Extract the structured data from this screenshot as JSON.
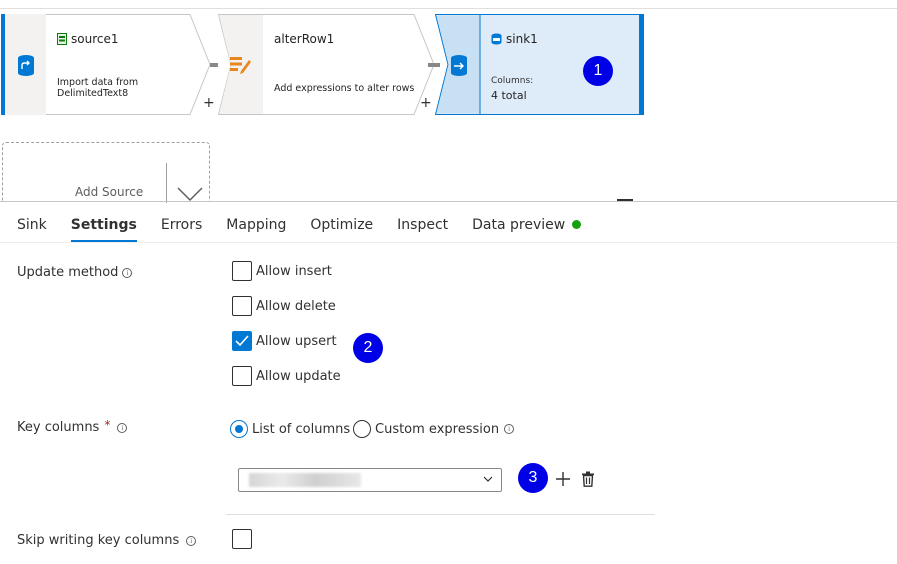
{
  "flow": {
    "source": {
      "title": "source1",
      "desc_line1": "Import data from",
      "desc_line2": "DelimitedText8"
    },
    "alter": {
      "title": "alterRow1",
      "desc": "Add expressions to alter rows"
    },
    "sink": {
      "title": "sink1",
      "columns_label": "Columns:",
      "columns_value": "4 total"
    },
    "plus": "+",
    "add_source": "Add Source",
    "accent": "#0078d4"
  },
  "badges": [
    "1",
    "2",
    "3"
  ],
  "tabs": [
    "Sink",
    "Settings",
    "Errors",
    "Mapping",
    "Optimize",
    "Inspect",
    "Data preview"
  ],
  "active_tab": "Settings",
  "settings": {
    "update_method_label": "Update method",
    "options": [
      {
        "label": "Allow insert",
        "checked": false
      },
      {
        "label": "Allow delete",
        "checked": false
      },
      {
        "label": "Allow upsert",
        "checked": true
      },
      {
        "label": "Allow update",
        "checked": false
      }
    ],
    "key_columns_label": "Key columns",
    "required_marker": "*",
    "radio_list": "List of columns",
    "radio_custom": "Custom expression",
    "selected_radio": "List of columns",
    "skip_label": "Skip writing key columns",
    "skip_checked": false
  },
  "icons": [
    "source-icon",
    "alter-row-icon",
    "sink-icon",
    "info-icon",
    "plus-icon",
    "delete-icon",
    "chevron-down-icon",
    "checkmark-icon",
    "status-dot"
  ]
}
